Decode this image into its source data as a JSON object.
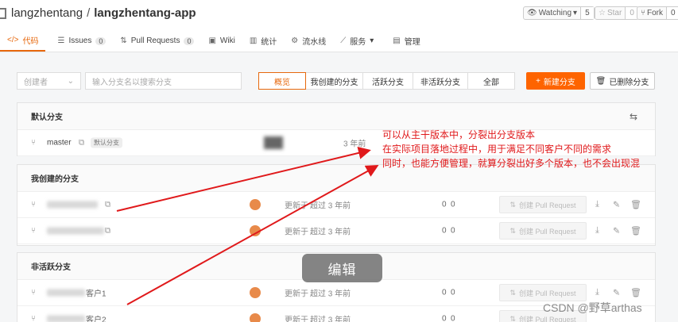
{
  "header": {
    "owner": "langzhentang",
    "separator": "/",
    "repo": "langzhentang-app",
    "watching": {
      "label": "Watching",
      "caret": "▾",
      "count": "5"
    },
    "star": {
      "label": "Star",
      "count": "0"
    },
    "fork": {
      "label": "Fork",
      "count": "0"
    }
  },
  "tabs": [
    {
      "icon": "</>",
      "label": "代码",
      "active": true
    },
    {
      "icon": "☰",
      "label": "Issues",
      "badge": "0"
    },
    {
      "icon": "⇅",
      "label": "Pull Requests",
      "badge": "0"
    },
    {
      "icon": "▣",
      "label": "Wiki"
    },
    {
      "icon": "▥",
      "label": "统计"
    },
    {
      "icon": "⚙",
      "label": "流水线"
    },
    {
      "icon": "⟋",
      "label": "服务",
      "caret": "▾"
    },
    {
      "icon": "▤",
      "label": "管理"
    }
  ],
  "filters": {
    "creator_placeholder": "创建者",
    "search_placeholder": "输入分支名以搜索分支"
  },
  "segments": [
    "概览",
    "我创建的分支",
    "活跃分支",
    "非活跃分支",
    "全部"
  ],
  "actions": {
    "new_branch": "新建分支",
    "new_branch_icon": "+",
    "deleted_branches": "已删除分支",
    "deleted_icon": "🗑"
  },
  "sections": {
    "default": {
      "title": "默认分支",
      "row": {
        "name": "master",
        "tag": "默认分支",
        "time": "3 年前"
      }
    },
    "mine": {
      "title": "我创建的分支",
      "rows": [
        {
          "updated": "更新于",
          "time": "超过 3 年前",
          "ahead": "0",
          "behind": "0",
          "pr": "创建 Pull Request"
        },
        {
          "updated": "更新于",
          "time": "超过 3 年前",
          "ahead": "0",
          "behind": "0",
          "pr": "创建 Pull Request"
        }
      ]
    },
    "inactive": {
      "title": "非活跃分支",
      "rows": [
        {
          "name_fragment": "客户1",
          "updated": "更新于",
          "time": "超过 3 年前",
          "ahead": "0",
          "behind": "0",
          "pr": "创建 Pull Request"
        },
        {
          "name_fragment": "客户2",
          "updated": "更新于",
          "time": "超过 3 年前",
          "ahead": "0",
          "behind": "0",
          "pr": "创建 Pull Request"
        }
      ]
    }
  },
  "annotation": {
    "line1": "可以从主干版本中，分裂出分支版本",
    "line2": "在实际项目落地过程中，用于满足不同客户不同的需求",
    "line3": "同时，也能方便管理，就算分裂出好多个版本，也不会出现混",
    "color": "#e0191b"
  },
  "edit_tip": "编辑",
  "watermark": "CSDN @野草arthas",
  "colors": {
    "accent": "#e7680d",
    "primary_button": "#fe6400"
  }
}
